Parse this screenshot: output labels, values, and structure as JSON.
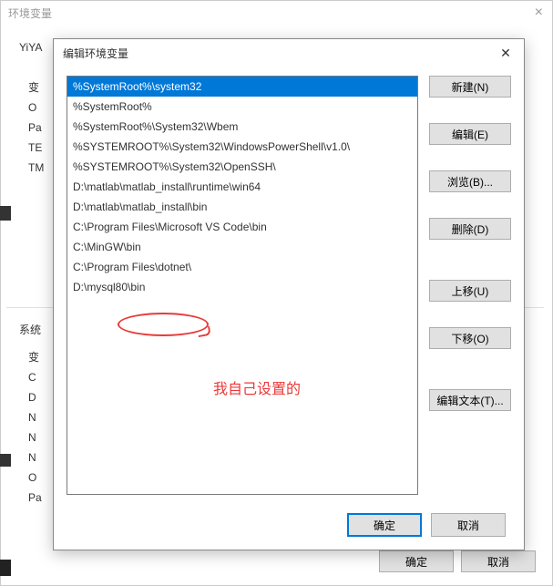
{
  "outer": {
    "title": "环境变量",
    "user_label": "YiYA",
    "sys_label": "系统",
    "user_headers": [
      "变",
      "O",
      "Pa",
      "TE",
      "TM"
    ],
    "sys_headers": [
      "变",
      "C",
      "D",
      "N",
      "N",
      "N",
      "O",
      "Pa"
    ],
    "ok": "确定",
    "cancel": "取消"
  },
  "inner": {
    "title": "编辑环境变量",
    "items": [
      "%SystemRoot%\\system32",
      "%SystemRoot%",
      "%SystemRoot%\\System32\\Wbem",
      "%SYSTEMROOT%\\System32\\WindowsPowerShell\\v1.0\\",
      "%SYSTEMROOT%\\System32\\OpenSSH\\",
      "D:\\matlab\\matlab_install\\runtime\\win64",
      "D:\\matlab\\matlab_install\\bin",
      "C:\\Program Files\\Microsoft VS Code\\bin",
      "C:\\MinGW\\bin",
      "C:\\Program Files\\dotnet\\",
      "D:\\mysql80\\bin"
    ],
    "selected_index": 0,
    "buttons": {
      "new": "新建(N)",
      "edit": "编辑(E)",
      "browse": "浏览(B)...",
      "delete": "删除(D)",
      "moveup": "上移(U)",
      "movedown": "下移(O)",
      "edittext": "编辑文本(T)..."
    },
    "ok": "确定",
    "cancel": "取消"
  },
  "annotation": "我自己设置的"
}
